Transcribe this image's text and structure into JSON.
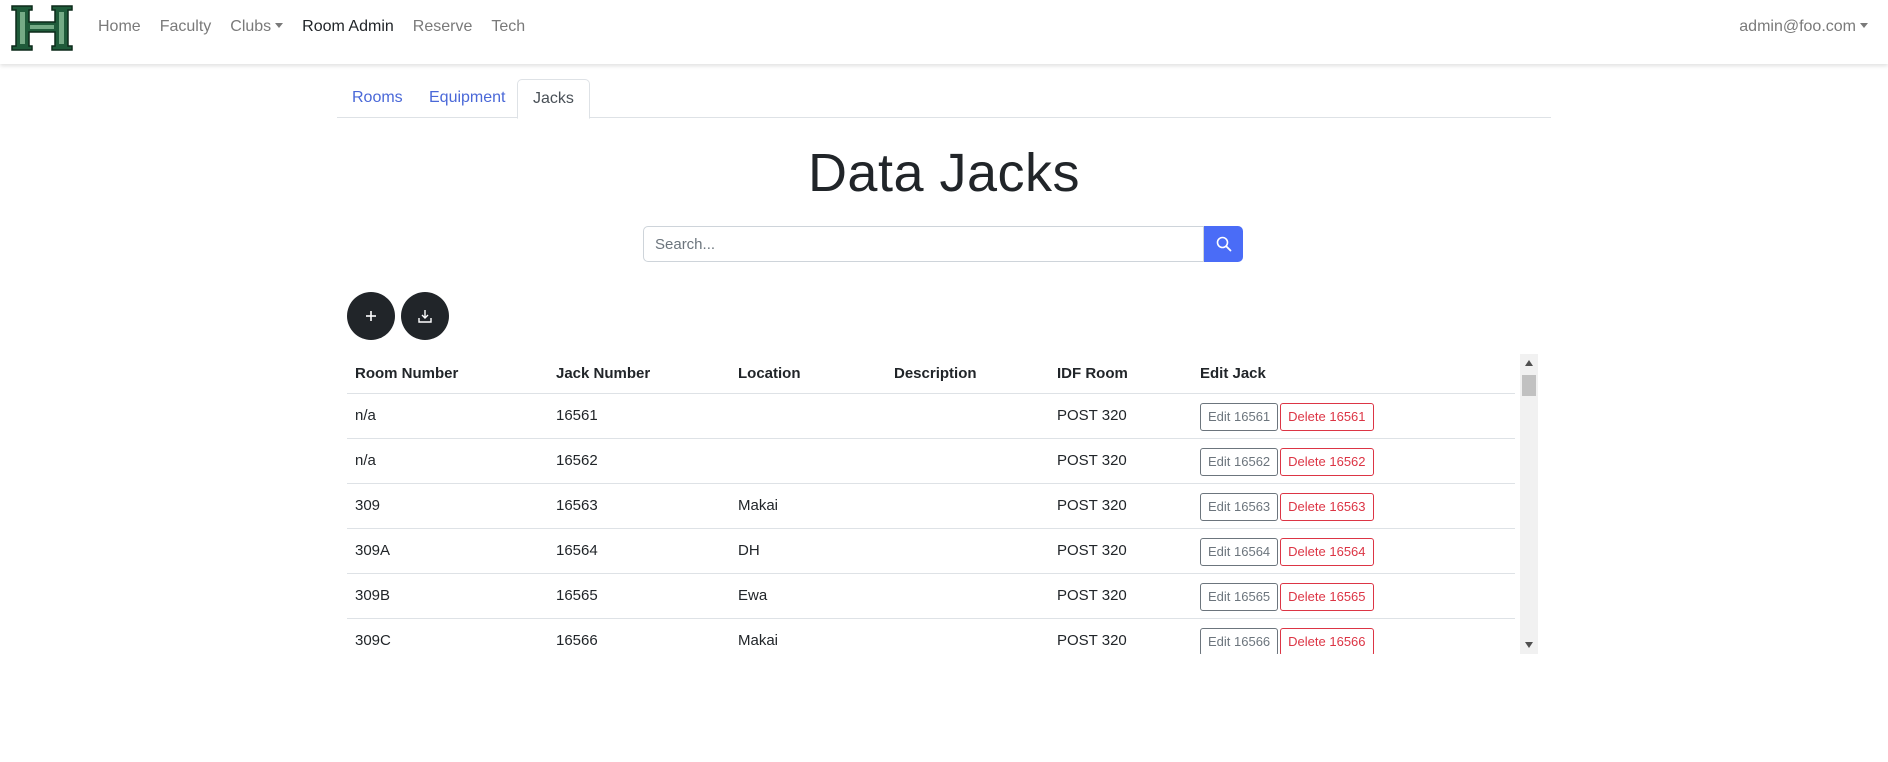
{
  "nav": {
    "logo_alt": "H",
    "links": [
      "Home",
      "Faculty",
      "Clubs",
      "Room Admin",
      "Reserve",
      "Tech"
    ],
    "user": "admin@foo.com"
  },
  "tabs": [
    "Rooms",
    "Equipment",
    "Jacks"
  ],
  "page_title": "Data Jacks",
  "search": {
    "placeholder": "Search..."
  },
  "table": {
    "headers": [
      "Room Number",
      "Jack Number",
      "Location",
      "Description",
      "IDF Room",
      "Edit Jack"
    ],
    "rows": [
      {
        "room": "n/a",
        "jack": "16561",
        "location": "",
        "description": "",
        "idf": "POST 320",
        "edit": "Edit 16561",
        "delete": "Delete 16561"
      },
      {
        "room": "n/a",
        "jack": "16562",
        "location": "",
        "description": "",
        "idf": "POST 320",
        "edit": "Edit 16562",
        "delete": "Delete 16562"
      },
      {
        "room": "309",
        "jack": "16563",
        "location": "Makai",
        "description": "",
        "idf": "POST 320",
        "edit": "Edit 16563",
        "delete": "Delete 16563"
      },
      {
        "room": "309A",
        "jack": "16564",
        "location": "DH",
        "description": "",
        "idf": "POST 320",
        "edit": "Edit 16564",
        "delete": "Delete 16564"
      },
      {
        "room": "309B",
        "jack": "16565",
        "location": "Ewa",
        "description": "",
        "idf": "POST 320",
        "edit": "Edit 16565",
        "delete": "Delete 16565"
      },
      {
        "room": "309C",
        "jack": "16566",
        "location": "Makai",
        "description": "",
        "idf": "POST 320",
        "edit": "Edit 16566",
        "delete": "Delete 16566"
      }
    ]
  },
  "colors": {
    "primary": "#4a6cf7",
    "link": "#4a68d8",
    "danger": "#dc3545",
    "secondary": "#6c757d",
    "dark": "#212529",
    "logo_green": "#1f5b3a"
  }
}
